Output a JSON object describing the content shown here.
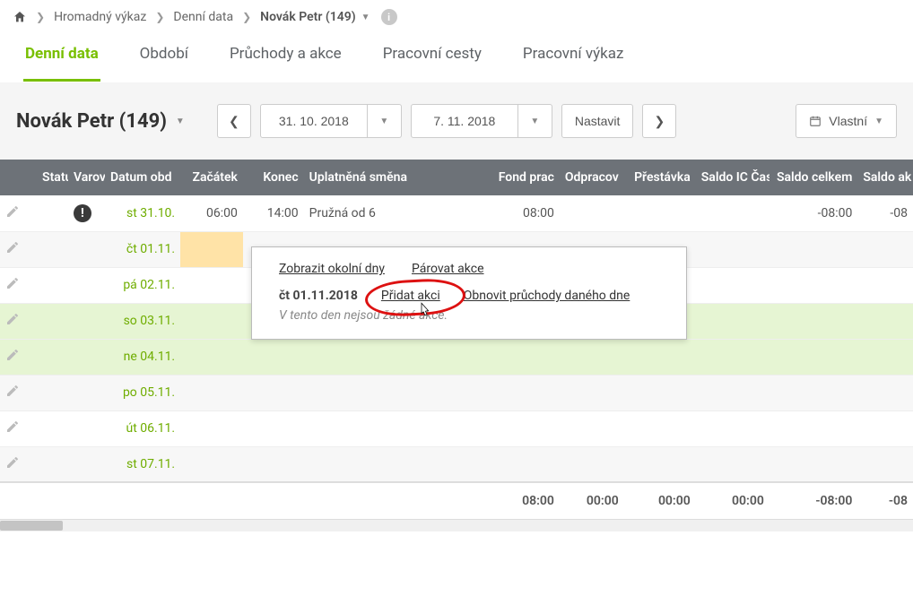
{
  "breadcrumb": {
    "items": [
      "Hromadný výkaz",
      "Denní data",
      "Novák Petr (149)"
    ]
  },
  "tabs": [
    "Denní data",
    "Období",
    "Průchody a akce",
    "Pracovní cesty",
    "Pracovní výkaz"
  ],
  "toolbar": {
    "person": "Novák Petr (149)",
    "date_from": "31. 10. 2018",
    "date_to": "7. 11. 2018",
    "set_label": "Nastavit",
    "custom_label": "Vlastní"
  },
  "table": {
    "headers": {
      "status": "Statu",
      "varov": "Varov",
      "datum": "Datum obd",
      "zacatek": "Začátek",
      "konec": "Konec",
      "smena": "Uplatněná směna",
      "fond": "Fond prac",
      "odprac": "Odpracov",
      "prest": "Přestávka",
      "saldo_ic": "Saldo IC Čas",
      "saldo_celkem": "Saldo celkem",
      "saldo_ak": "Saldo ak"
    },
    "rows": [
      {
        "date": "st 31.10.",
        "zac": "06:00",
        "kon": "14:00",
        "smena": "Pružná od 6",
        "fond": "08:00",
        "saldo_celkem": "-08:00",
        "saldo_ak": "-08",
        "warn": true,
        "weekend": false,
        "highlightZac": false
      },
      {
        "date": "čt 01.11.",
        "weekend": false,
        "highlightZac": true
      },
      {
        "date": "pá 02.11.",
        "weekend": false
      },
      {
        "date": "so 03.11.",
        "weekend": true
      },
      {
        "date": "ne 04.11.",
        "weekend": true
      },
      {
        "date": "po 05.11.",
        "weekend": false
      },
      {
        "date": "út 06.11.",
        "weekend": false
      },
      {
        "date": "st 07.11.",
        "weekend": false
      }
    ],
    "footer": {
      "fond": "08:00",
      "odprac": "00:00",
      "prest": "00:00",
      "saldo_ic": "00:00",
      "saldo_celkem": "-08:00",
      "saldo_ak": "-08"
    }
  },
  "popover": {
    "link_okolni": "Zobrazit okolní dny",
    "link_parovat": "Párovat akce",
    "date": "čt 01.11.2018",
    "link_pridat": "Přidat akci",
    "link_obnovit": "Obnovit průchody daného dne",
    "empty_msg": "V tento den nejsou žádné akce."
  }
}
